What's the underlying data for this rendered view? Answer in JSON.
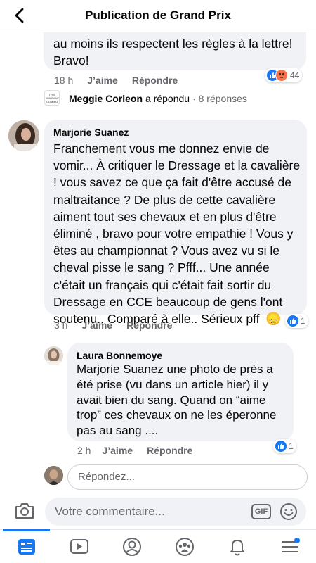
{
  "header": {
    "title": "Publication de Grand Prix"
  },
  "top_comment": {
    "text_line1": "au moins ils respectent les règles à la lettre!",
    "text_line2": "Bravo!",
    "time": "18 h",
    "like_label": "J’aime",
    "reply_label": "Répondre",
    "reactions": {
      "count": "44",
      "types": [
        "like",
        "angry"
      ]
    },
    "reply_summary": {
      "name": "Meggie Corleon",
      "action": "a répondu",
      "count": "· 8 réponses",
      "avatar_text": "THIS WARNING COMBAT"
    }
  },
  "comment_marjorie": {
    "author": "Marjorie Suanez",
    "text": "Franchement vous me donnez envie de vomir... À critiquer le Dressage et la cavalière ! vous savez ce que ça fait d'être accusé de maltraitance ? De plus de cette cavalière aiment tout ses chevaux et en plus d'être éliminé  , bravo pour votre empathie ! Vous y êtes au championnat ? Vous avez vu si le cheval pisse le sang ? Pfff... Une année c'était un français qui c'était fait sortir du Dressage en CCE beaucoup de gens l'ont soutenu.. Comparé à elle.. Sérieux pff",
    "emoji": "😞",
    "time": "3 h",
    "like_label": "J’aime",
    "reply_label": "Répondre",
    "reactions": {
      "count": "1",
      "types": [
        "like"
      ]
    }
  },
  "comment_laura": {
    "author": "Laura Bonnemoye",
    "text": "Marjorie Suanez une photo de près a été prise (vu dans un article hier) il y avait bien du sang. Quand on “aime trop” ces chevaux on ne les éperonne pas au sang ....",
    "time": "2 h",
    "like_label": "J’aime",
    "reply_label": "Répondre",
    "reactions": {
      "count": "1",
      "types": [
        "like"
      ]
    }
  },
  "reply_box": {
    "placeholder": "Répondez..."
  },
  "composer": {
    "placeholder": "Votre commentaire...",
    "gif_label": "GIF"
  },
  "tabbar": {
    "items": [
      "news-feed-icon",
      "video-icon",
      "profile-icon",
      "groups-icon",
      "notifications-icon",
      "menu-icon"
    ],
    "active": "news-feed-icon"
  },
  "colors": {
    "accent": "#1877f2",
    "angry": "#f7714b",
    "bubble": "#f0f2f5",
    "muted": "#65676b"
  }
}
